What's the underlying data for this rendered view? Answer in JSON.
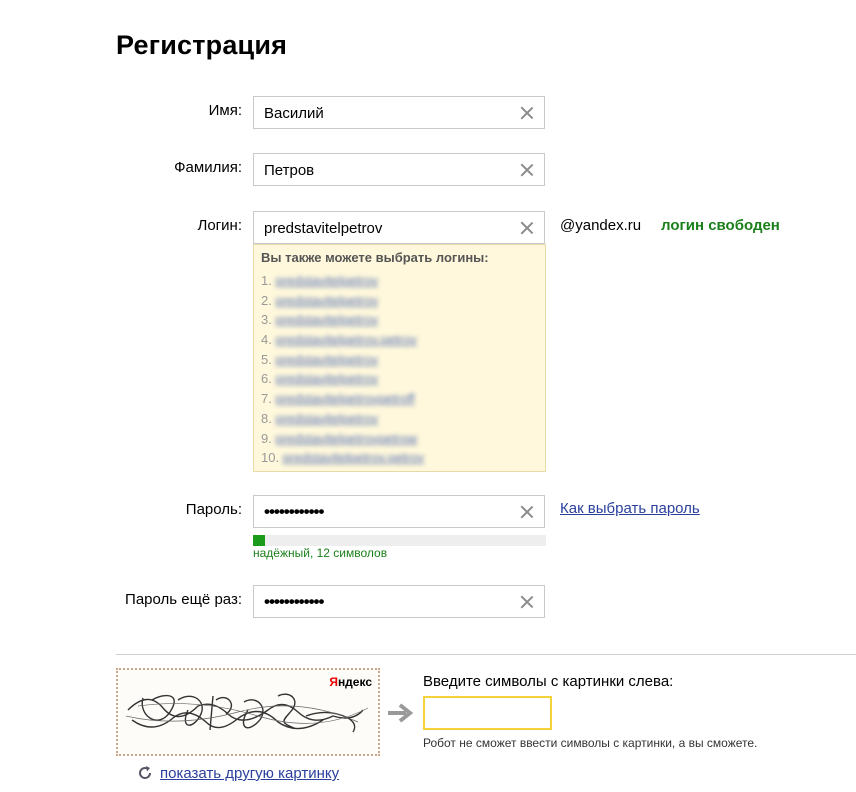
{
  "page": {
    "title": "Регистрация"
  },
  "form": {
    "first_name": {
      "label": "Имя:",
      "value": "Василий"
    },
    "last_name": {
      "label": "Фамилия:",
      "value": "Петров"
    },
    "login": {
      "label": "Логин:",
      "value": "predstavitelpetrov",
      "domain": "@yandex.ru",
      "status": "логин свободен",
      "status_color": "#1a7f1a"
    },
    "suggestions": {
      "title": "Вы также можете выбрать логины:",
      "items": [
        {
          "num": "1.",
          "login": "predstavitelpetrov"
        },
        {
          "num": "2.",
          "login": "predstavitelpetrov"
        },
        {
          "num": "3.",
          "login": "predstavitelpetrov"
        },
        {
          "num": "4.",
          "login": "predstavitelpetrov.petrov"
        },
        {
          "num": "5.",
          "login": "predstavitelpetrov"
        },
        {
          "num": "6.",
          "login": "predstavitelpetrov"
        },
        {
          "num": "7.",
          "login": "predstavitelpetrovpetroff"
        },
        {
          "num": "8.",
          "login": "predstavitelpetrov"
        },
        {
          "num": "9.",
          "login": "predstavitelpetrovpetrow"
        },
        {
          "num": "10.",
          "login": "predstavitelpetrov.petrov"
        }
      ]
    },
    "password": {
      "label": "Пароль:",
      "value": "••••••••••••",
      "help_link": "Как выбрать пароль",
      "strength_text": "надёжный, 12 символов",
      "strength_color": "#1a9c1a"
    },
    "password_repeat": {
      "label": "Пароль ещё раз:",
      "value": "••••••••••••"
    }
  },
  "captcha": {
    "brand": "Яндекс",
    "prompt": "Введите символы с картинки слева:",
    "note": "Робот не сможет ввести символы с картинки, а вы сможете.",
    "refresh_link": "показать другую картинку",
    "accent_color": "#f5d23a"
  },
  "icons": {
    "clear": "close-icon",
    "arrow": "arrow-right-icon",
    "refresh": "refresh-icon"
  }
}
